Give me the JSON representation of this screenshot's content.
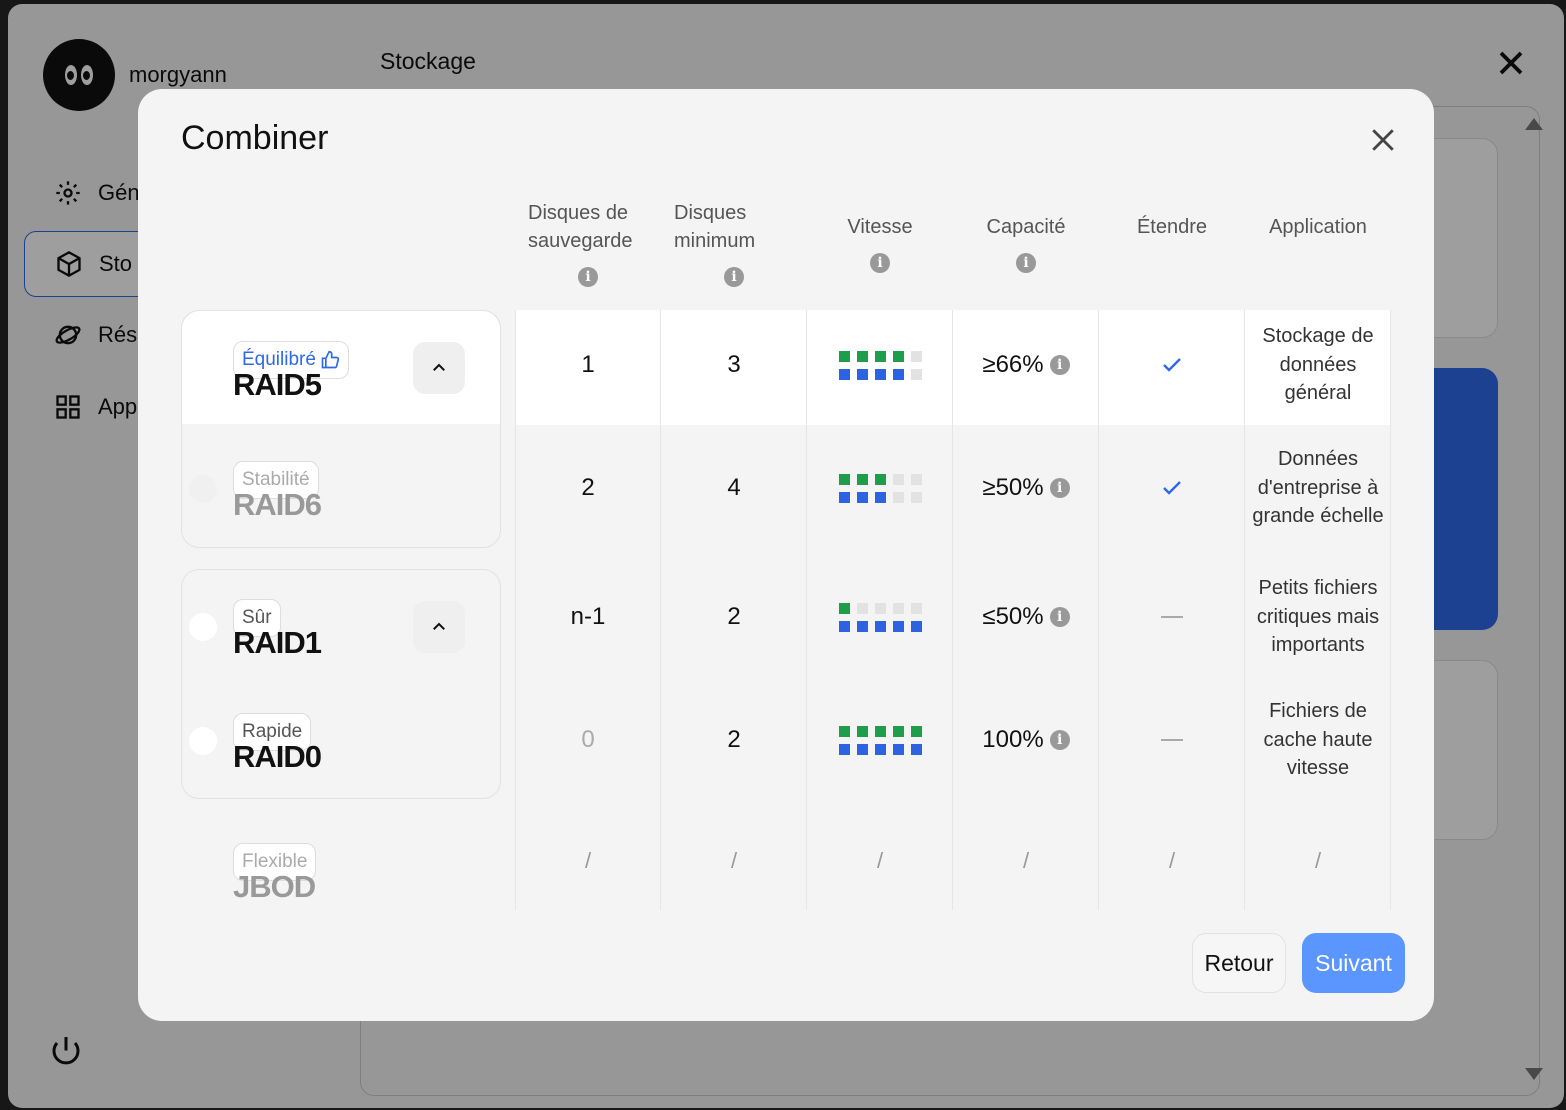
{
  "app": {
    "username": "morgyann",
    "page_title": "Stockage",
    "sidebar": [
      {
        "label": "Gén",
        "icon": "gear-icon"
      },
      {
        "label": "Sto",
        "icon": "box-icon"
      },
      {
        "label": "Rés",
        "icon": "planet-icon"
      },
      {
        "label": "App",
        "icon": "apps-grid-icon"
      }
    ]
  },
  "modal": {
    "title": "Combiner",
    "columns": [
      {
        "label": "Disques de sauvegarde",
        "info": true
      },
      {
        "label": "Disques minimum",
        "info": true
      },
      {
        "label": "Vitesse",
        "info": true
      },
      {
        "label": "Capacité",
        "info": true
      },
      {
        "label": "Étendre",
        "info": false
      },
      {
        "label": "Application",
        "info": false
      }
    ],
    "rows": [
      {
        "badge": "Équilibré",
        "name": "RAID5",
        "backup": "1",
        "min": "3",
        "speed": {
          "green": 4,
          "blue": 4
        },
        "capacity": "≥66%",
        "extend": "check",
        "application": "Stockage de données général",
        "selected": true
      },
      {
        "badge": "Stabilité",
        "name": "RAID6",
        "backup": "2",
        "min": "4",
        "speed": {
          "green": 3,
          "blue": 3
        },
        "capacity": "≥50%",
        "extend": "check",
        "application": "Données d'entreprise à grande échelle"
      },
      {
        "badge": "Sûr",
        "name": "RAID1",
        "backup": "n-1",
        "min": "2",
        "speed": {
          "green": 1,
          "blue": 5
        },
        "capacity": "≤50%",
        "extend": "dash",
        "application": "Petits fichiers critiques mais importants"
      },
      {
        "badge": "Rapide",
        "name": "RAID0",
        "backup": "0",
        "min": "2",
        "speed": {
          "green": 5,
          "blue": 5
        },
        "capacity": "100%",
        "extend": "dash",
        "application": "Fichiers de cache haute vitesse"
      },
      {
        "badge": "Flexible",
        "name": "JBOD",
        "backup": "/",
        "min": "/",
        "speed": "/",
        "capacity": "/",
        "extend": "/",
        "application": "/"
      }
    ],
    "buttons": {
      "back": "Retour",
      "next": "Suivant"
    },
    "info_glyph": "i"
  },
  "colors": {
    "accent": "#2d6ae8",
    "green": "#1e9e4a",
    "blue": "#2d63e0",
    "next_button": "#5b96ff"
  }
}
